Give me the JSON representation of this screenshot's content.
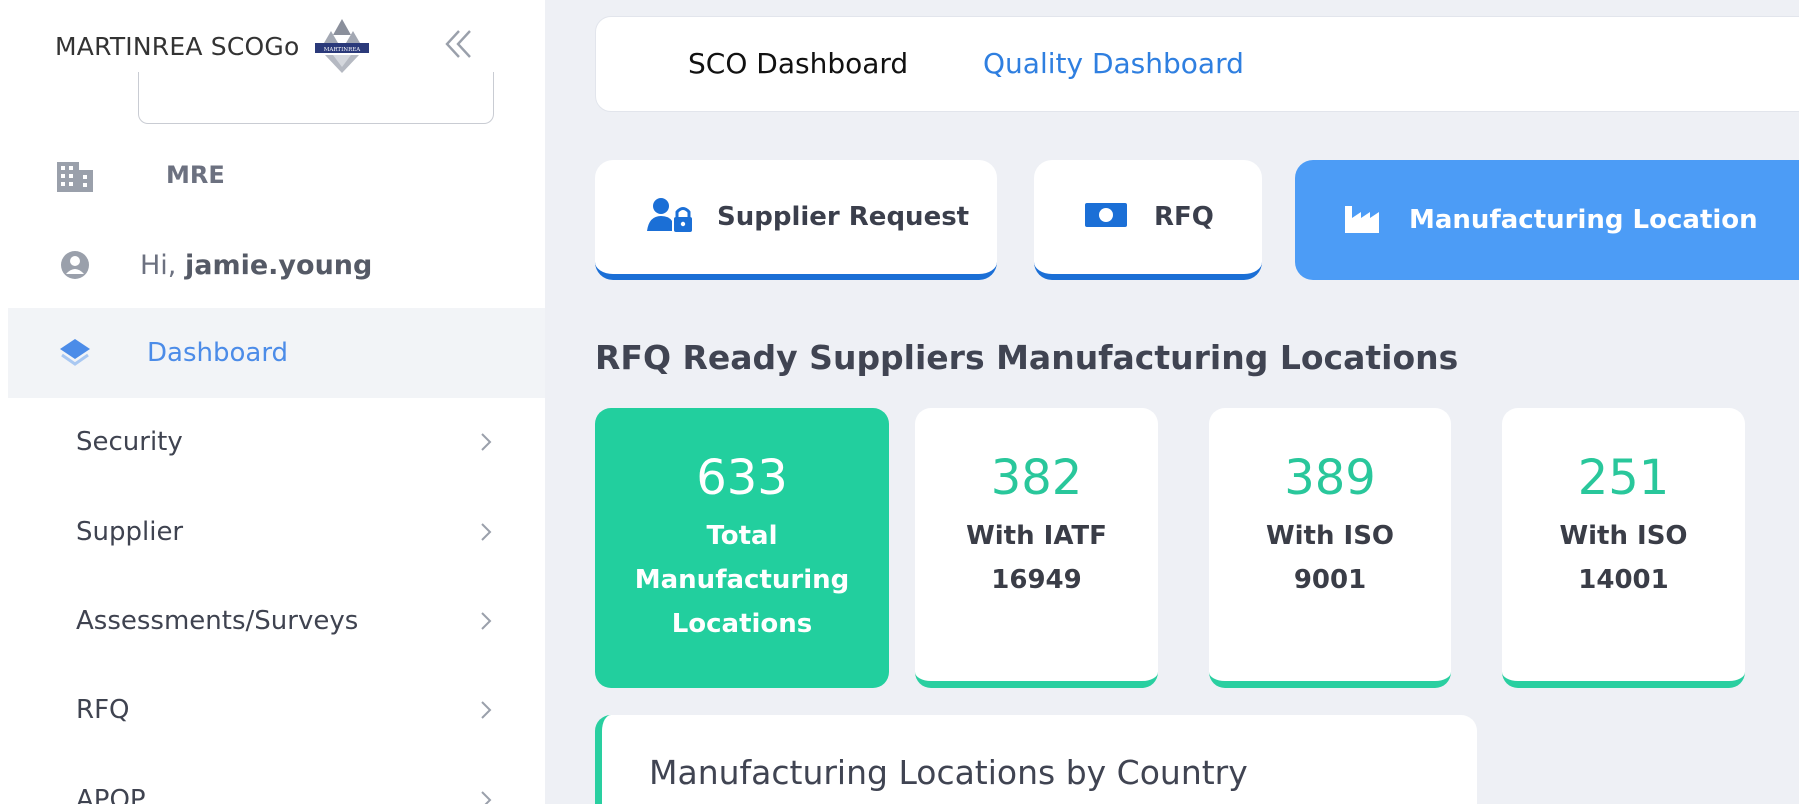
{
  "app": {
    "brand_name": "MARTINREA SCOGo",
    "logo_text": "MARTINREA"
  },
  "sidebar": {
    "org_label": "MRE",
    "greeting_prefix": "Hi, ",
    "username": "jamie.young",
    "active_item": "Dashboard",
    "items": [
      {
        "label": "Security"
      },
      {
        "label": "Supplier"
      },
      {
        "label": "Assessments/Surveys"
      },
      {
        "label": "RFQ"
      },
      {
        "label": "APQP"
      }
    ]
  },
  "header": {
    "tabs": [
      {
        "label": "SCO Dashboard",
        "active": true
      },
      {
        "label": "Quality Dashboard",
        "active": false
      }
    ]
  },
  "category_tabs": [
    {
      "label": "Supplier Request",
      "icon": "user-lock-icon",
      "active": false
    },
    {
      "label": "RFQ",
      "icon": "money-bill-icon",
      "active": false
    },
    {
      "label": "Manufacturing Location",
      "icon": "industry-icon",
      "active": true
    }
  ],
  "section": {
    "title": "RFQ Ready Suppliers Manufacturing Locations"
  },
  "stats": [
    {
      "value": "633",
      "line1": "Total",
      "line2": "Manufacturing",
      "line3": "Locations"
    },
    {
      "value": "382",
      "line1": "With IATF",
      "line2": "16949"
    },
    {
      "value": "389",
      "line1": "With ISO",
      "line2": "9001"
    },
    {
      "value": "251",
      "line1": "With ISO",
      "line2": "14001"
    }
  ],
  "country_card": {
    "title": "Manufacturing Locations by Country"
  },
  "colors": {
    "accent_blue": "#4c9cf6",
    "link_blue": "#2f7fe0",
    "tab_underline": "#1b6fd6",
    "accent_green": "#22cf9e",
    "stat_green": "#29c79b",
    "main_bg": "#eef0f5"
  }
}
